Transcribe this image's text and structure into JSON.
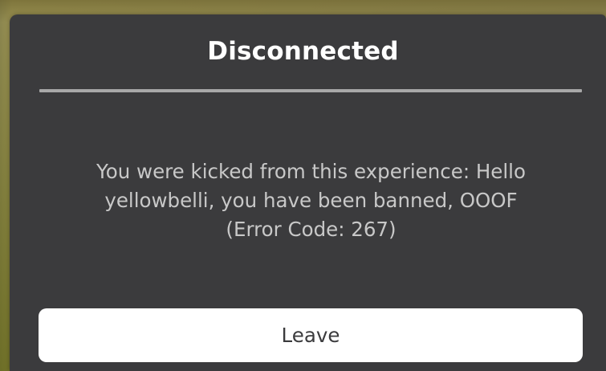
{
  "dialog": {
    "title": "Disconnected",
    "message_lines": [
      "You were kicked from this experience: Hello",
      "yellowbelli, you have been banned, OOOF",
      "(Error Code: 267)"
    ],
    "leave_label": "Leave"
  },
  "colors": {
    "dialog_background": "#3b3b3d",
    "title_text": "#ffffff",
    "message_text": "#c8c8c8",
    "divider": "#a8a8a8",
    "button_background": "#ffffff",
    "button_text": "#3b3b3d"
  }
}
